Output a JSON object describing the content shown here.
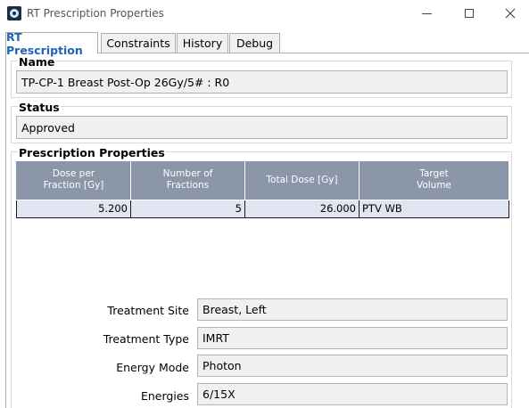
{
  "window": {
    "title": "RT Prescription Properties",
    "icon": "app-logo-icon"
  },
  "tabs": [
    {
      "label": "RT Prescription",
      "active": true
    },
    {
      "label": "Constraints",
      "active": false
    },
    {
      "label": "History",
      "active": false
    },
    {
      "label": "Debug",
      "active": false
    }
  ],
  "name_group": {
    "label": "Name",
    "value": "TP-CP-1 Breast Post-Op 26Gy/5# : R0"
  },
  "status_group": {
    "label": "Status",
    "value": "Approved"
  },
  "prescription_group": {
    "label": "Prescription Properties",
    "table": {
      "headers": [
        [
          "Dose per",
          "Fraction [Gy]"
        ],
        [
          "Number of",
          "Fractions"
        ],
        [
          "Total Dose [Gy]"
        ],
        [
          "Target",
          "Volume"
        ]
      ],
      "rows": [
        [
          "5.200",
          "5",
          "26.000",
          "PTV WB"
        ]
      ]
    }
  },
  "properties": [
    {
      "label": "Treatment Site",
      "value": "Breast, Left"
    },
    {
      "label": "Treatment Type",
      "value": "IMRT"
    },
    {
      "label": "Energy Mode",
      "value": "Photon"
    },
    {
      "label": "Energies",
      "value": "6/15X"
    }
  ],
  "colors": {
    "active_tab_text": "#1e64b4",
    "table_header_bg": "#8b96a8",
    "table_row_bg": "#dfe6f1",
    "field_bg": "#f0f0f0"
  }
}
